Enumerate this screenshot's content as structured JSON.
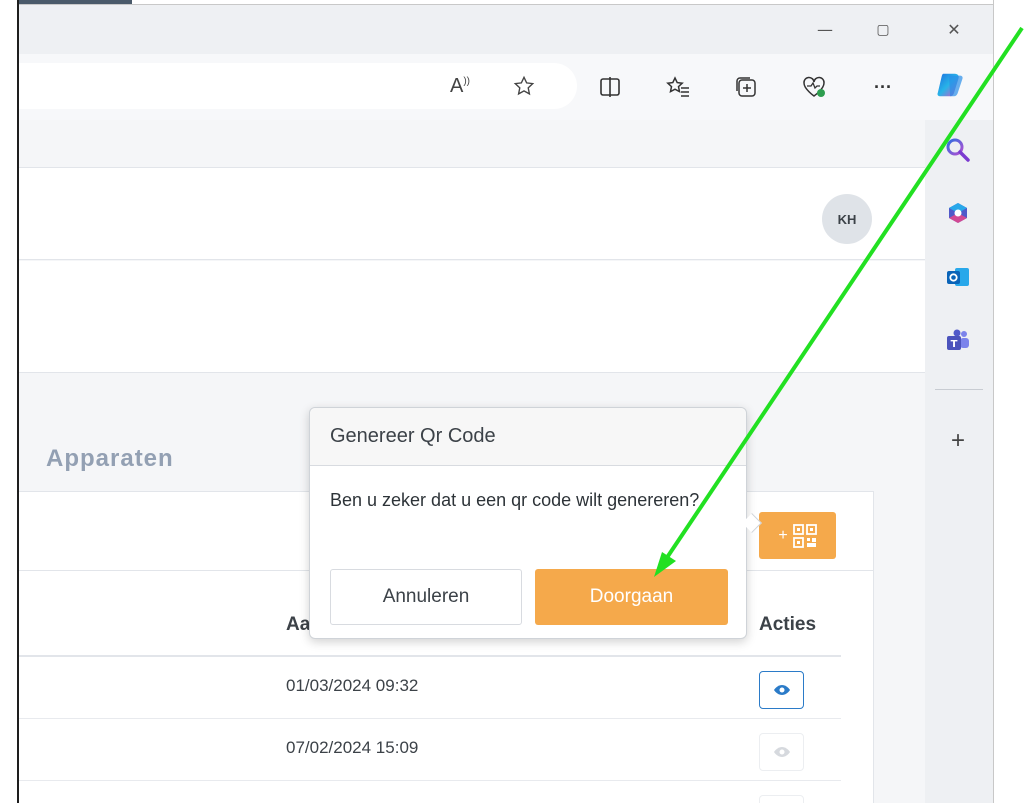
{
  "browser": {
    "window_buttons": {
      "minimize": "—",
      "restore": "▢",
      "close": "✕"
    },
    "toolbar_icons": [
      "read-aloud-icon",
      "favorite-star-icon",
      "split-screen-icon",
      "favorites-icon",
      "collections-icon",
      "browser-essentials-icon",
      "more-icon",
      "copilot-icon"
    ],
    "read_aloud_text": "A",
    "more_text": "···"
  },
  "header": {
    "avatar_initials": "KH"
  },
  "page": {
    "tab_title": "Apparaten",
    "table": {
      "headers": {
        "date": "Aa",
        "actions": "Acties"
      },
      "rows": [
        {
          "date": "01/03/2024 09:32",
          "active": true
        },
        {
          "date": "07/02/2024 15:09",
          "active": false
        },
        {
          "date": "",
          "active": false
        }
      ]
    },
    "qr_add_plus": "+"
  },
  "popover": {
    "title": "Genereer Qr Code",
    "body": "Ben u zeker dat u een qr code wilt genereren?",
    "cancel_label": "Annuleren",
    "confirm_label": "Doorgaan"
  },
  "sidebar": {
    "icons": [
      "search-icon",
      "microsoft365-icon",
      "outlook-icon",
      "teams-icon"
    ],
    "add_label": "+"
  },
  "colors": {
    "accent": "#f5a94b",
    "eye_active": "#2b7bc8",
    "annotation_arrow": "#22e022"
  }
}
